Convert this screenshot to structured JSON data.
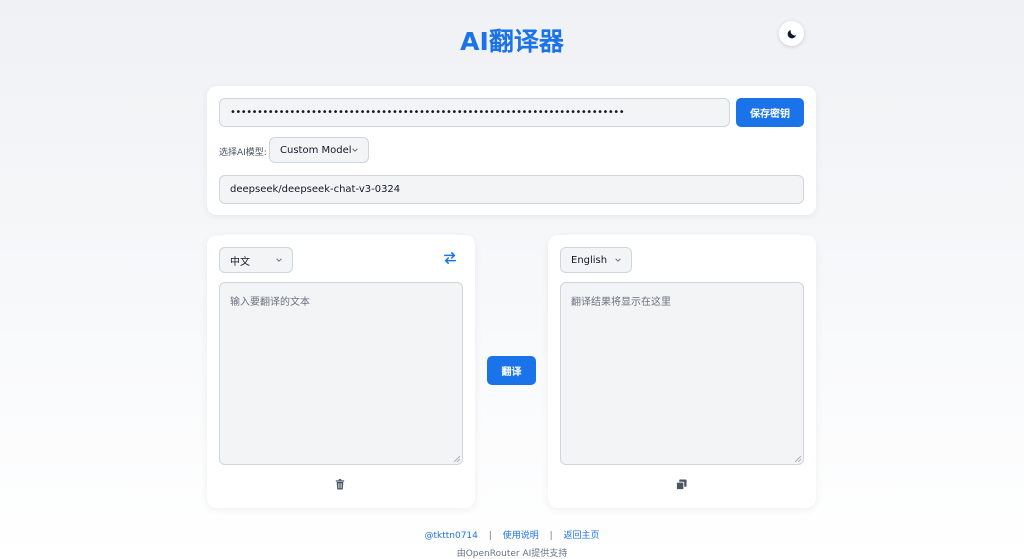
{
  "header": {
    "title": "AI翻译器",
    "theme_icon": "moon-icon"
  },
  "config": {
    "api_key_value": "•••••••••••••••••••••••••••••••••••••••••••••••••••••••••••••••••••••••••",
    "save_key_label": "保存密钥",
    "model_label": "选择AI模型:",
    "model_selected": "Custom Model",
    "model_id_value": "deepseek/deepseek-chat-v3-0324"
  },
  "source": {
    "language": "中文",
    "placeholder": "输入要翻译的文本",
    "swap_icon": "swap-arrows-icon",
    "clear_icon": "trash-icon"
  },
  "target": {
    "language": "English",
    "placeholder": "翻译结果将显示在这里",
    "copy_icon": "copy-icon"
  },
  "translate_label": "翻译",
  "footer": {
    "links": [
      "@tkttn0714",
      "使用说明",
      "返回主页"
    ],
    "separator": "|",
    "note": "由OpenRouter AI提供支持"
  },
  "colors": {
    "accent": "#1a73e8",
    "field_bg": "#f3f4f6",
    "border": "#d1d5db"
  }
}
